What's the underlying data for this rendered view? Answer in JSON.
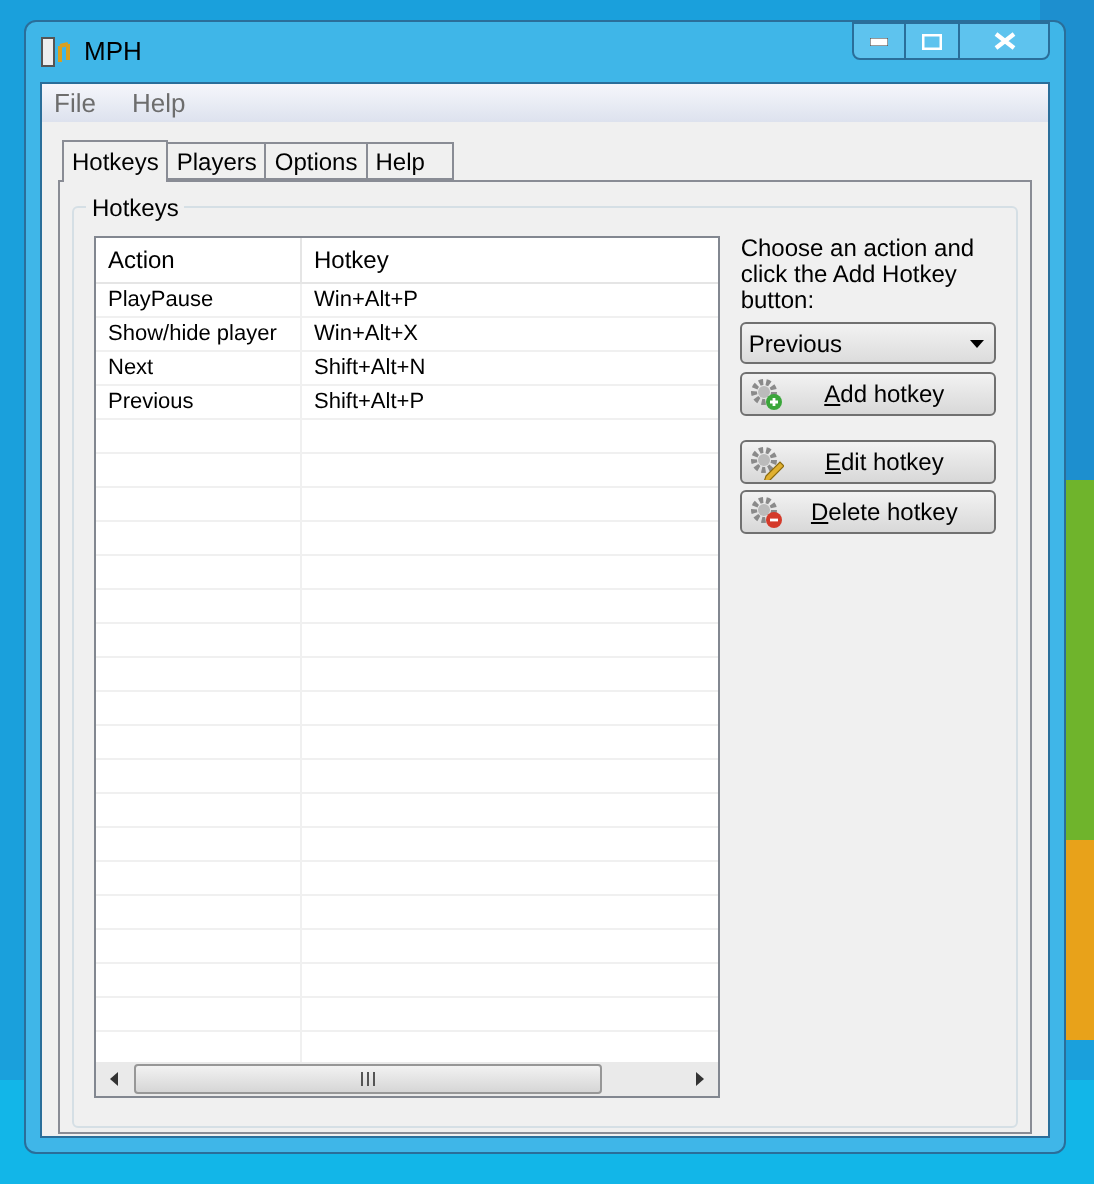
{
  "window": {
    "title": "MPH"
  },
  "menu": [
    "File",
    "Help"
  ],
  "tabs": [
    {
      "label": "Hotkeys",
      "selected": true
    },
    {
      "label": "Players",
      "selected": false
    },
    {
      "label": "Options",
      "selected": false
    },
    {
      "label": "Help",
      "selected": false
    }
  ],
  "group": {
    "title": "Hotkeys"
  },
  "table": {
    "columns": [
      "Action",
      "Hotkey"
    ],
    "rows": [
      [
        "PlayPause",
        "Win+Alt+P"
      ],
      [
        "Show/hide player",
        "Win+Alt+X"
      ],
      [
        "Next",
        "Shift+Alt+N"
      ],
      [
        "Previous",
        "Shift+Alt+P"
      ]
    ]
  },
  "instructions": "Choose an action and click the Add Hotkey button:",
  "action_select": {
    "value": "Previous"
  },
  "buttons": [
    {
      "label": "Add hotkey",
      "kind": "add"
    },
    {
      "label": "Edit hotkey",
      "kind": "edit"
    },
    {
      "label": "Delete hotkey",
      "kind": "delete"
    }
  ]
}
